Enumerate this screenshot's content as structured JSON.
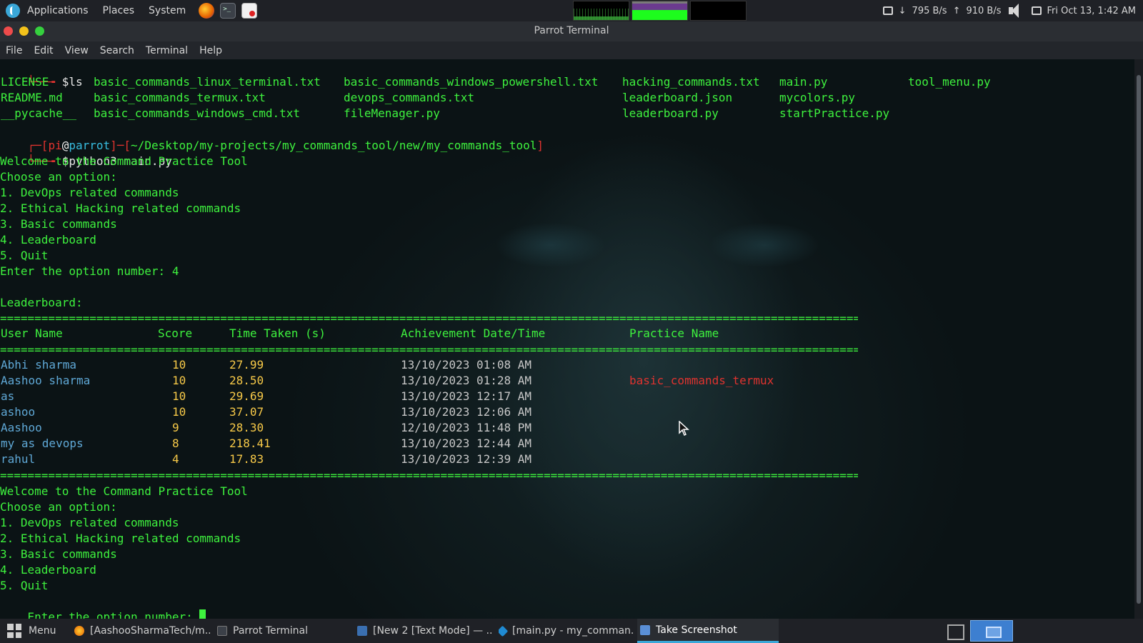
{
  "top_panel": {
    "menus": [
      "Applications",
      "Places",
      "System"
    ],
    "net_down": "795 B/s",
    "net_up": "910 B/s",
    "clock": "Fri Oct 13,  1:42 AM"
  },
  "window": {
    "title": "Parrot Terminal",
    "menu": [
      "File",
      "Edit",
      "View",
      "Search",
      "Terminal",
      "Help"
    ]
  },
  "terminal": {
    "cmd1": "$ls",
    "ls": [
      [
        "LICENSE",
        "basic_commands_linux_terminal.txt",
        "basic_commands_windows_powershell.txt",
        "hacking_commands.txt",
        "main.py",
        "tool_menu.py"
      ],
      [
        "README.md",
        "basic_commands_termux.txt",
        "devops_commands.txt",
        "leaderboard.json",
        "mycolors.py",
        ""
      ],
      [
        "__pycache__",
        "basic_commands_windows_cmd.txt",
        "fileMenager.py",
        "leaderboard.py",
        "startPractice.py",
        ""
      ]
    ],
    "prompt_user": "pi",
    "prompt_at": "@",
    "prompt_host": "parrot",
    "prompt_path": "~/Desktop/my-projects/my_commands_tool/new/my_commands_tool",
    "cmd2": "$python3 main.py",
    "welcome": "Welcome to the Command Practice Tool",
    "choose": "Choose an option:",
    "options": [
      "1. DevOps related commands",
      "2. Ethical Hacking related commands",
      "3. Basic commands",
      "4. Leaderboard",
      "5. Quit"
    ],
    "enter_first": "Enter the option number: 4",
    "leaderboard_label": "Leaderboard:",
    "separator": "================================================================================================================================================================",
    "headers": [
      "User Name",
      "Score",
      "Time Taken (s)",
      "Achievement Date/Time",
      "Practice Name"
    ],
    "rows": [
      {
        "user": "Abhi sharma",
        "score": "10",
        "time": "27.99",
        "date": "13/10/2023 01:08 AM",
        "practice": ""
      },
      {
        "user": "Aashoo sharma",
        "score": "10",
        "time": "28.50",
        "date": "13/10/2023 01:28 AM",
        "practice": "basic_commands_termux"
      },
      {
        "user": "as",
        "score": "10",
        "time": "29.69",
        "date": "13/10/2023 12:17 AM",
        "practice": ""
      },
      {
        "user": "ashoo",
        "score": "10",
        "time": "37.07",
        "date": "13/10/2023 12:06 AM",
        "practice": ""
      },
      {
        "user": "Aashoo",
        "score": "9",
        "time": "28.30",
        "date": "12/10/2023 11:48 PM",
        "practice": ""
      },
      {
        "user": "my as devops",
        "score": "8",
        "time": "218.41",
        "date": "13/10/2023 12:44 AM",
        "practice": ""
      },
      {
        "user": "rahul",
        "score": "4",
        "time": "17.83",
        "date": "13/10/2023 12:39 AM",
        "practice": ""
      }
    ],
    "enter_prompt": "Enter the option number: "
  },
  "taskbar": {
    "menu_label": "Menu",
    "tasks": [
      "[AashooSharmaTech/m...",
      "Parrot Terminal",
      "[New 2 [Text Mode] — ...",
      "[main.py - my_comman...",
      "Take Screenshot"
    ]
  },
  "colors": {
    "green": "#3ef23e",
    "red": "#e0332f",
    "yellow": "#f7c948",
    "accent": "#3aa7d8"
  }
}
